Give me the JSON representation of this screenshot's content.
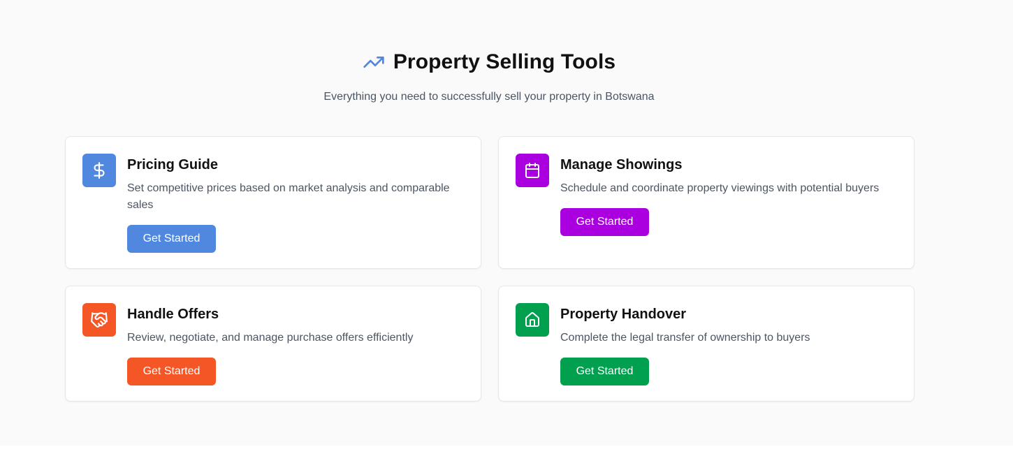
{
  "header": {
    "title": "Property Selling Tools",
    "subtitle": "Everything you need to successfully sell your property in Botswana",
    "icon": "trending-up-icon",
    "icon_color": "#4f86e0"
  },
  "cards": [
    {
      "title": "Pricing Guide",
      "description": "Set competitive prices based on market analysis and comparable sales",
      "button_label": "Get Started",
      "icon": "dollar-icon",
      "color": "#5088e0"
    },
    {
      "title": "Manage Showings",
      "description": "Schedule and coordinate property viewings with potential buyers",
      "button_label": "Get Started",
      "icon": "calendar-icon",
      "color": "#aa00e0"
    },
    {
      "title": "Handle Offers",
      "description": "Review, negotiate, and manage purchase offers efficiently",
      "button_label": "Get Started",
      "icon": "handshake-icon",
      "color": "#f55625"
    },
    {
      "title": "Property Handover",
      "description": "Complete the legal transfer of ownership to buyers",
      "button_label": "Get Started",
      "icon": "home-icon",
      "color": "#00a04f"
    }
  ]
}
